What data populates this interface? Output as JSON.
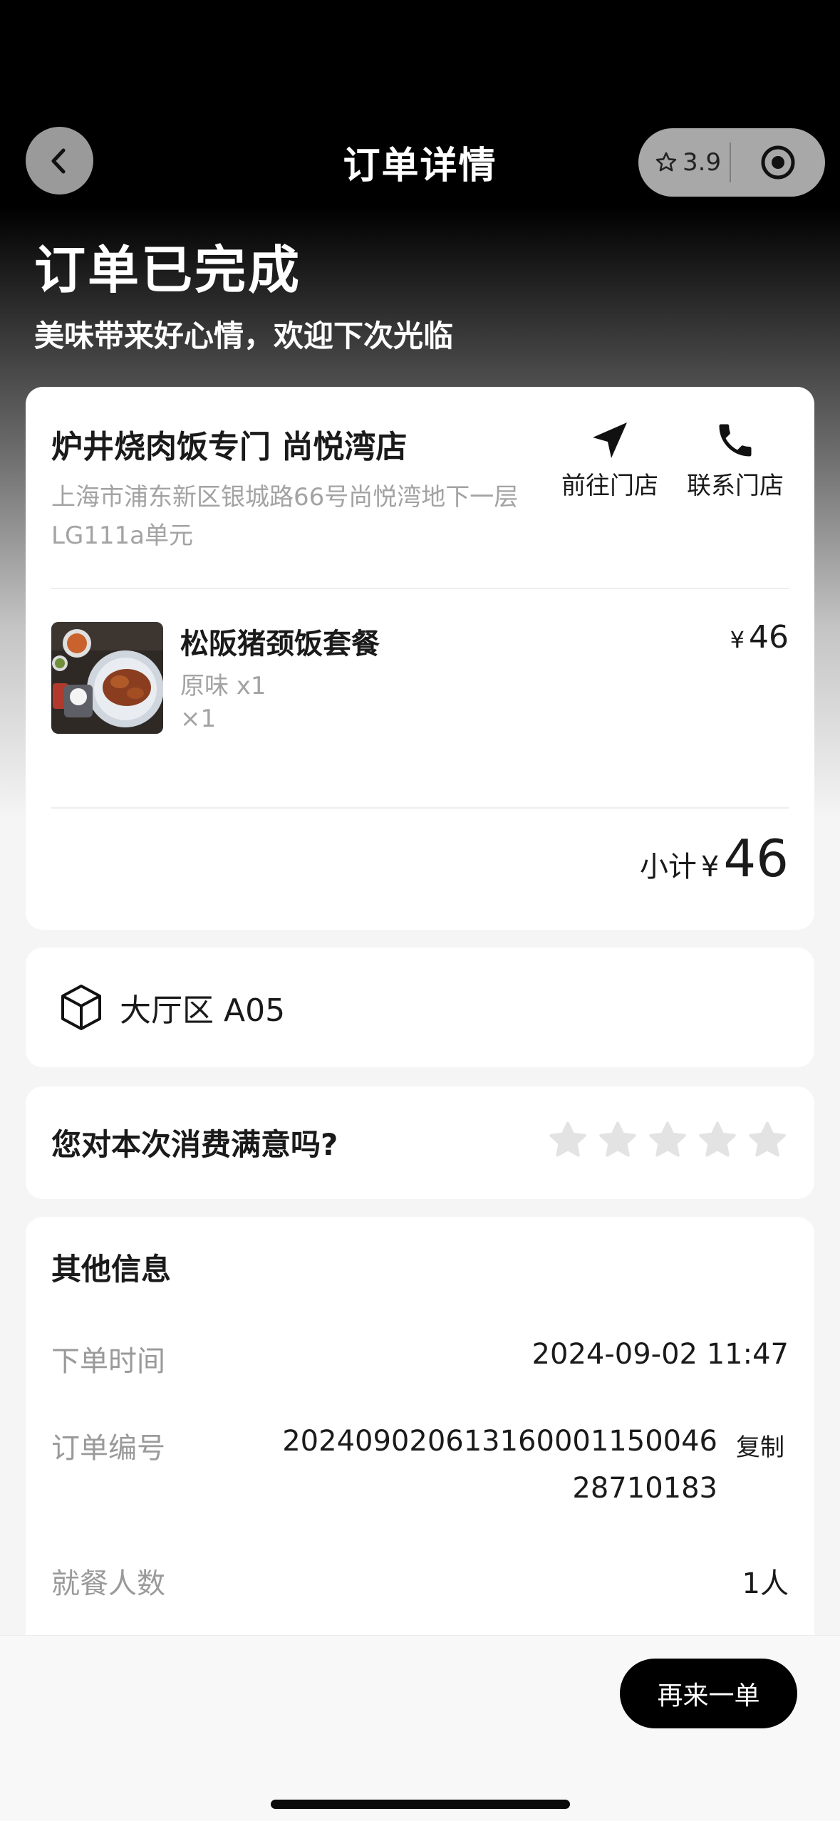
{
  "nav": {
    "title": "订单详情",
    "rating": "3.9"
  },
  "status": {
    "title": "订单已完成",
    "subtitle": "美味带来好心情，欢迎下次光临"
  },
  "store": {
    "name": "炉井烧肉饭专门 尚悦湾店",
    "address": "上海市浦东新区银城路66号尚悦湾地下一层LG111a单元",
    "navigate_label": "前往门店",
    "call_label": "联系门店"
  },
  "item": {
    "name": "松阪猪颈饭套餐",
    "spec": "原味 x1",
    "qty": "×1",
    "currency": "¥",
    "price": "46"
  },
  "subtotal": {
    "label": "小计",
    "currency": "¥",
    "amount": "46"
  },
  "table": {
    "label": "大厅区 A05"
  },
  "rating": {
    "question": "您对本次消费满意吗?",
    "stars_total": 5,
    "stars_selected": 0
  },
  "info": {
    "title": "其他信息",
    "order_time_label": "下单时间",
    "order_time": "2024-09-02 11:47",
    "order_no_label": "订单编号",
    "order_no_line1": "202409020613160001150046",
    "order_no_line2": "28710183",
    "copy_label": "复制",
    "diners_label": "就餐人数",
    "diners": "1人"
  },
  "footer": {
    "reorder_label": "再来一单"
  },
  "colors": {
    "primary": "#000000",
    "star_empty": "#e3e3e3",
    "muted_text": "#a3a3a3"
  }
}
